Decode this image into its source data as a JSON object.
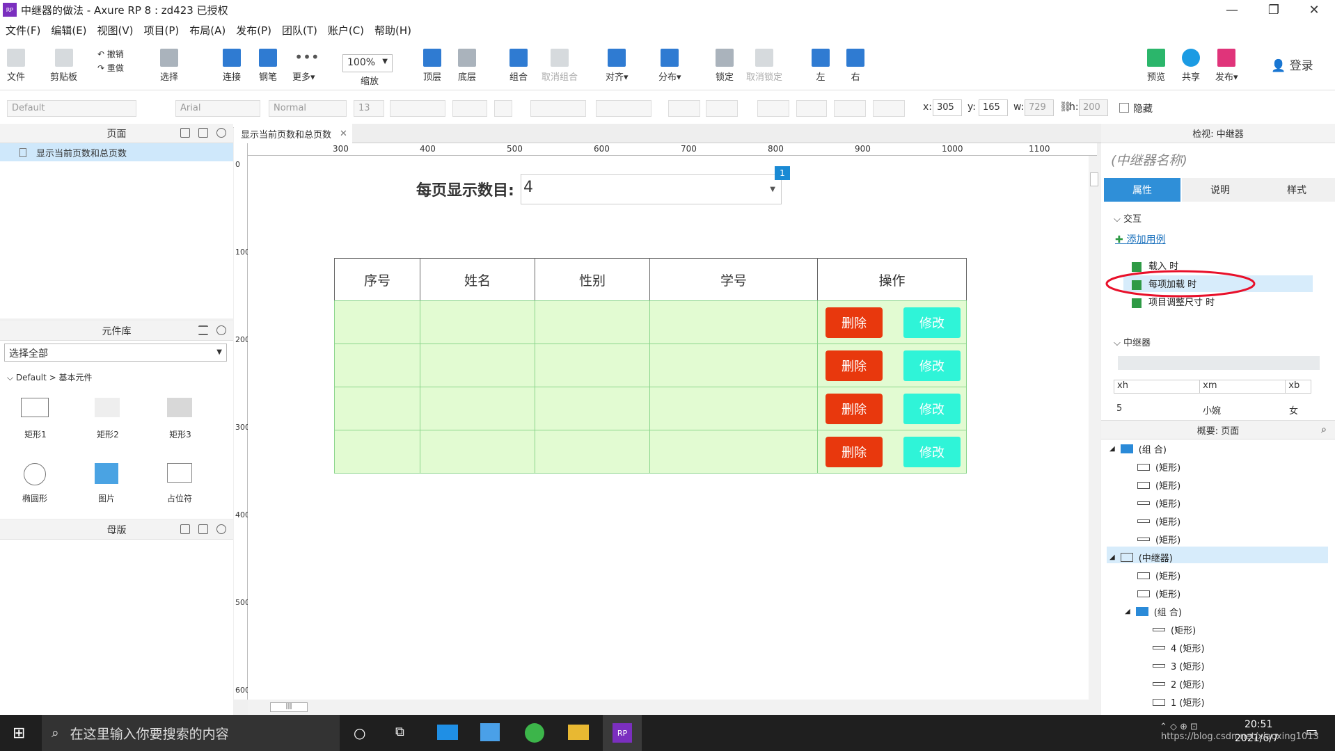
{
  "window": {
    "title": "中继器的做法 - Axure RP 8 : zd423 已授权",
    "app_badge": "RP"
  },
  "menu": [
    "文件(F)",
    "编辑(E)",
    "视图(V)",
    "项目(P)",
    "布局(A)",
    "发布(P)",
    "团队(T)",
    "账户(C)",
    "帮助(H)"
  ],
  "toolbar": {
    "file": "文件",
    "clipboard": "剪贴板",
    "undo": "撤销",
    "redo": "重做",
    "select": "选择",
    "connect": "连接",
    "pen": "钢笔",
    "more": "更多▾",
    "zoom_value": "100%",
    "zoom_label": "缩放",
    "top": "顶层",
    "bottom": "底层",
    "group": "组合",
    "ungroup": "取消组合",
    "align": "对齐▾",
    "distribute": "分布▾",
    "lock": "锁定",
    "unlock": "取消锁定",
    "left": "左",
    "right": "右",
    "preview": "预览",
    "share": "共享",
    "publish": "发布▾",
    "login": "登录"
  },
  "format": {
    "style": "Default",
    "font": "Arial",
    "weight": "Normal",
    "size": "13",
    "x_label": "x:",
    "x": "305",
    "y_label": "y:",
    "y": "165",
    "w_label": "w:",
    "w": "729",
    "h_label": "h:",
    "h": "200",
    "hidden": "隐藏"
  },
  "pages_panel": {
    "title": "页面",
    "items": [
      "显示当前页数和总页数"
    ]
  },
  "library_panel": {
    "title": "元件库",
    "select": "选择全部",
    "group": "Default > 基本元件",
    "items": [
      "矩形1",
      "矩形2",
      "矩形3",
      "椭圆形",
      "图片",
      "占位符"
    ]
  },
  "masters_panel": {
    "title": "母版"
  },
  "canvas": {
    "tab": "显示当前页数和总页数",
    "ruler_h": [
      "300",
      "400",
      "500",
      "600",
      "700",
      "800",
      "900",
      "1000",
      "1100"
    ],
    "ruler_v": [
      "0",
      "100",
      "200",
      "300",
      "400",
      "500",
      "600"
    ],
    "per_page_label": "每页显示数目:",
    "per_page_value": "4",
    "badge": "1",
    "headers": [
      "序号",
      "姓名",
      "性别",
      "学号",
      "操作"
    ],
    "delete_label": "删除",
    "edit_label": "修改"
  },
  "inspector": {
    "title": "检视: 中继器",
    "name_placeholder": "(中继器名称)",
    "tabs": [
      "属性",
      "说明",
      "样式"
    ],
    "interaction": "交互",
    "add_case": "添加用例",
    "events": [
      "载入 时",
      "每项加载 时",
      "项目调整尺寸 时"
    ],
    "repeater": "中继器",
    "dataset_headers": [
      "xh",
      "xm",
      "xb"
    ],
    "dataset_row": [
      "5",
      "小婉",
      "女"
    ]
  },
  "outline": {
    "title": "概要: 页面",
    "items": [
      {
        "label": "(组 合)",
        "kind": "fold",
        "indent": 0
      },
      {
        "label": "(矩形)",
        "kind": "rect",
        "indent": 1
      },
      {
        "label": "(矩形)",
        "kind": "rect",
        "indent": 1
      },
      {
        "label": "(矩形)",
        "kind": "flat",
        "indent": 1
      },
      {
        "label": "(矩形)",
        "kind": "flat",
        "indent": 1
      },
      {
        "label": "(矩形)",
        "kind": "flat",
        "indent": 1
      },
      {
        "label": "(中继器)",
        "kind": "grid",
        "indent": 0
      },
      {
        "label": "(矩形)",
        "kind": "rect",
        "indent": 1
      },
      {
        "label": "(矩形)",
        "kind": "rect",
        "indent": 1
      },
      {
        "label": "(组 合)",
        "kind": "fold",
        "indent": 1
      },
      {
        "label": "(矩形)",
        "kind": "flat",
        "indent": 2
      },
      {
        "label": "4 (矩形)",
        "kind": "flat",
        "indent": 2
      },
      {
        "label": "3 (矩形)",
        "kind": "flat",
        "indent": 2
      },
      {
        "label": "2 (矩形)",
        "kind": "flat",
        "indent": 2
      },
      {
        "label": "1 (矩形)",
        "kind": "rect",
        "indent": 2
      }
    ]
  },
  "taskbar": {
    "search_placeholder": "在这里输入你要搜索的内容",
    "time": "20:51",
    "date": "2021/6/7",
    "watermark": "https://blog.csdn.net/xiaoxing1013"
  },
  "colors": {
    "accent": "#2f8fd8",
    "delete": "#e8380d",
    "edit": "#2ff4d8",
    "row": "#e2fbd2",
    "annotation": "#e8102a"
  }
}
